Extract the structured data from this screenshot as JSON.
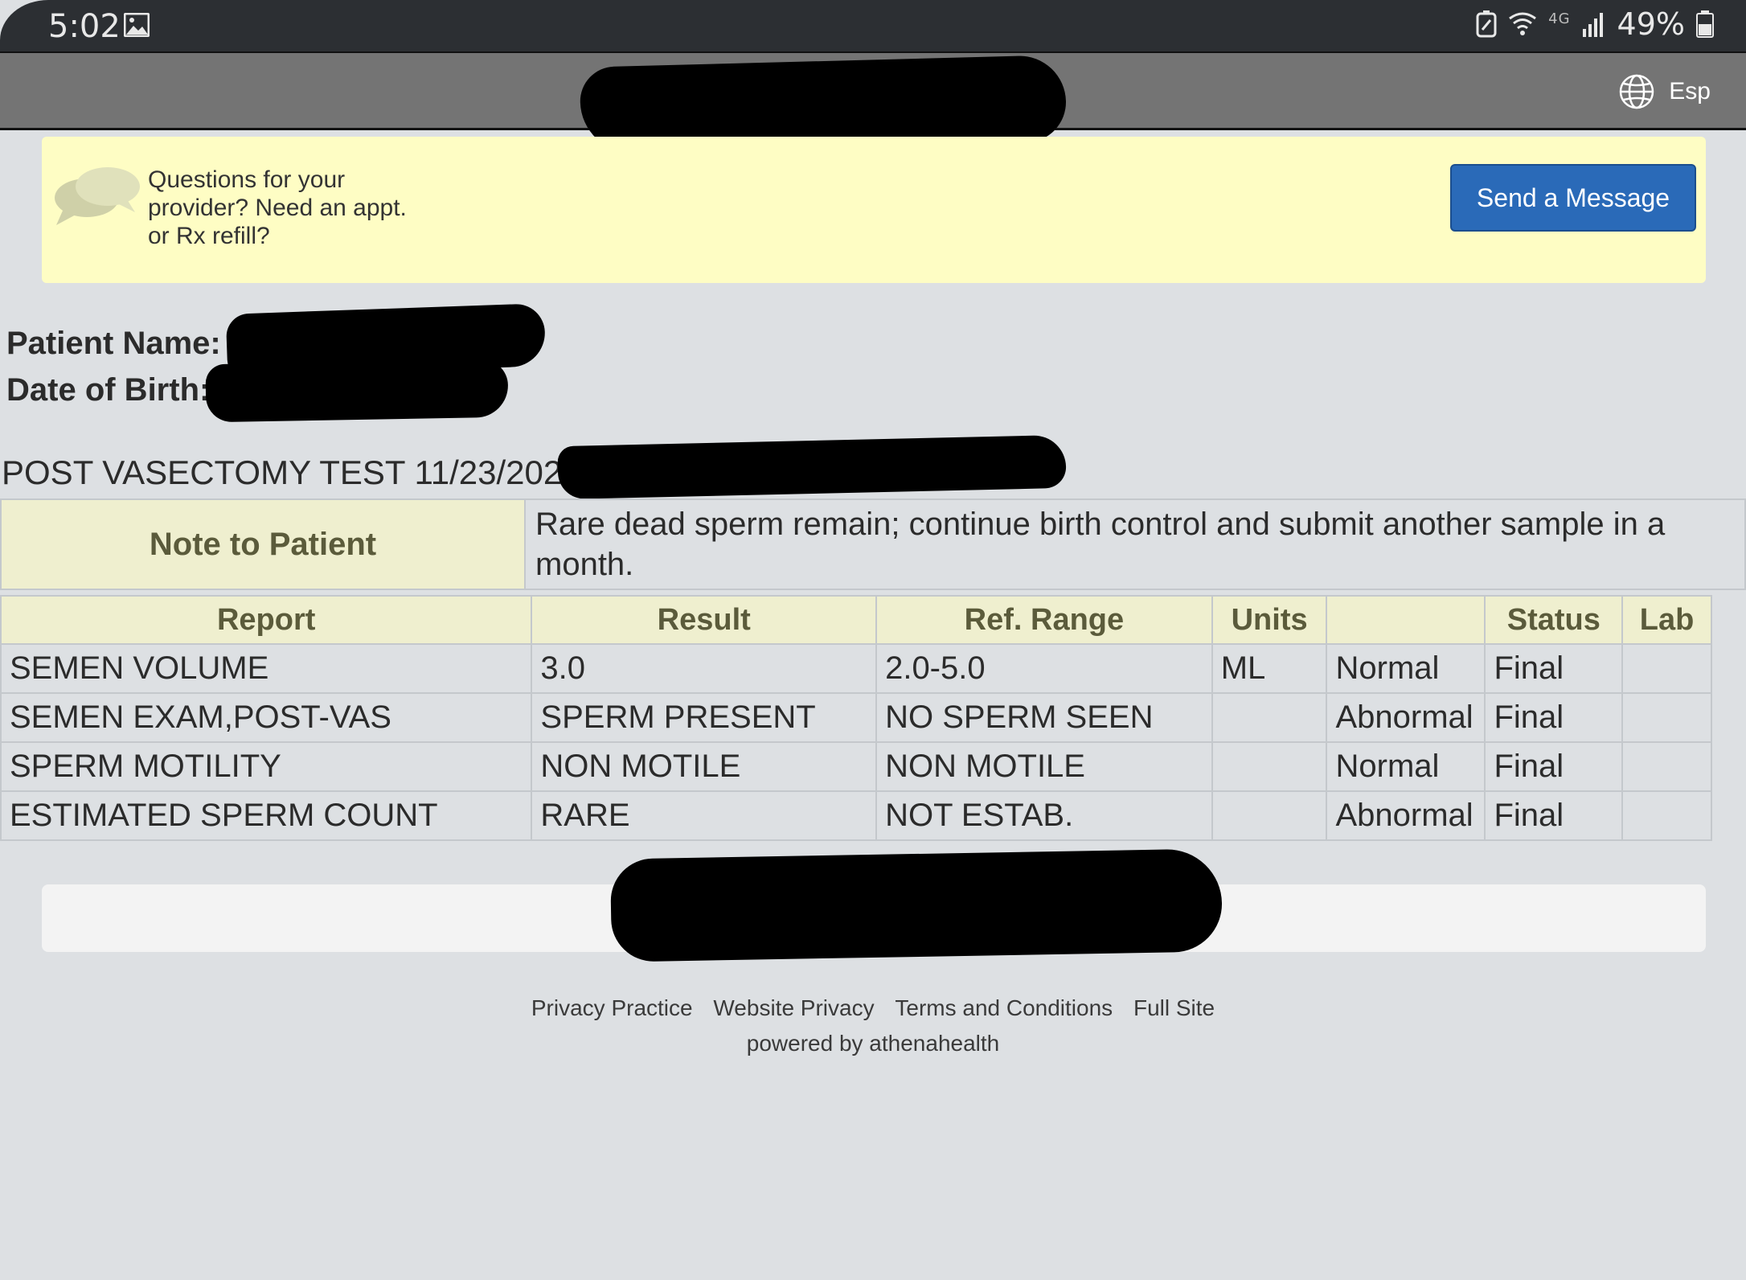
{
  "status_bar": {
    "time": "5:02",
    "battery": "49%",
    "network": "4G"
  },
  "header": {
    "language_label": "Esp"
  },
  "banner": {
    "question": "Questions for your provider? Need an appt. or Rx refill?",
    "send_button": "Send a Message"
  },
  "patient": {
    "name_label": "Patient Name:",
    "dob_label": "Date of Birth:"
  },
  "test": {
    "title": "POST VASECTOMY TEST 11/23/2020"
  },
  "note": {
    "label": "Note to Patient",
    "text": "Rare dead sperm remain; continue birth control and submit another sample in a month."
  },
  "results": {
    "headers": [
      "Report",
      "Result",
      "Ref. Range",
      "Units",
      "",
      "Status",
      "Lab"
    ],
    "rows": [
      [
        "SEMEN VOLUME",
        "3.0",
        "2.0-5.0",
        "ML",
        "Normal",
        "Final",
        ""
      ],
      [
        "SEMEN EXAM,POST-VAS",
        "SPERM PRESENT",
        "NO SPERM SEEN",
        "",
        "Abnormal",
        "Final",
        ""
      ],
      [
        "SPERM MOTILITY",
        "NON MOTILE",
        "NON MOTILE",
        "",
        "Normal",
        "Final",
        ""
      ],
      [
        "ESTIMATED SPERM COUNT",
        "RARE",
        "NOT ESTAB.",
        "",
        "Abnormal",
        "Final",
        ""
      ]
    ]
  },
  "footer": {
    "links": [
      "Privacy Practice",
      "Website Privacy",
      "Terms and Conditions",
      "Full Site"
    ],
    "powered_by": "powered by athenahealth"
  },
  "colors": {
    "header_bg": "#747474",
    "banner_bg": "#fefdc4",
    "button_bg": "#2a6ab8",
    "table_header_bg": "#efefcf",
    "page_bg": "#dde0e3"
  }
}
